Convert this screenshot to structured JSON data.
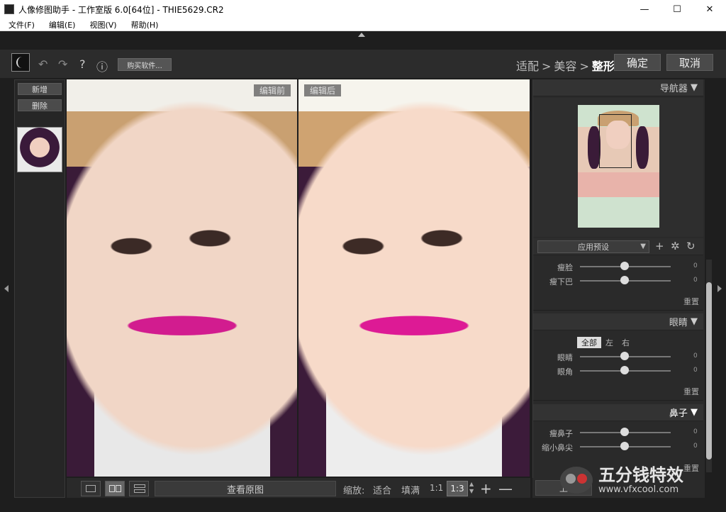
{
  "window": {
    "title": "人像修图助手 - 工作室版 6.0[64位] - THIE5629.CR2",
    "controls": [
      "—",
      "☐",
      "✕"
    ]
  },
  "menu": [
    "文件(F)",
    "编辑(E)",
    "视图(V)",
    "帮助(H)"
  ],
  "toolbar": {
    "buy_label": "购买软件...",
    "help_icon": "?",
    "info_icon": "ⓘ",
    "undo_icon": "↶",
    "redo_icon": "↷",
    "steps": [
      "适配",
      "美容",
      "整形"
    ],
    "step_sep": ">",
    "active_step": "整形",
    "confirm_label": "确定",
    "cancel_label": "取消"
  },
  "left_panel": {
    "add_label": "新增",
    "delete_label": "删除"
  },
  "panes": {
    "before_label": "编辑前",
    "after_label": "编辑后"
  },
  "bottom": {
    "view_original_label": "查看原图",
    "zoom_label": "缩放:",
    "fit_label": "适合",
    "fill_label": "填满",
    "one_to_one": "1:1",
    "zoom_value": "1:3",
    "plus": "+",
    "minus": "—"
  },
  "right_panel": {
    "navigator_title": "导航器",
    "preset_label": "应用预设",
    "face": {
      "sliders": [
        {
          "label": "瘦脸",
          "value": "0"
        },
        {
          "label": "瘦下巴",
          "value": "0"
        }
      ],
      "reset_label": "重置"
    },
    "eyes": {
      "title": "眼睛",
      "segments": [
        "全部",
        "左",
        "右"
      ],
      "selected_segment": "全部",
      "sliders": [
        {
          "label": "眼睛",
          "value": "0"
        },
        {
          "label": "眼角",
          "value": "0"
        }
      ],
      "reset_label": "重置"
    },
    "nose": {
      "title": "鼻子",
      "sliders": [
        {
          "label": "瘦鼻子",
          "value": "0"
        },
        {
          "label": "缩小鼻尖",
          "value": "0"
        }
      ],
      "reset_label": "重置"
    },
    "bottom_button": "上"
  },
  "watermark": {
    "name": "五分钱特效",
    "url": "www.vfxcool.com"
  },
  "colors": {
    "background": "#1e1e1e",
    "panel": "#2a2a2a",
    "lipstick": "#d21c8f"
  }
}
